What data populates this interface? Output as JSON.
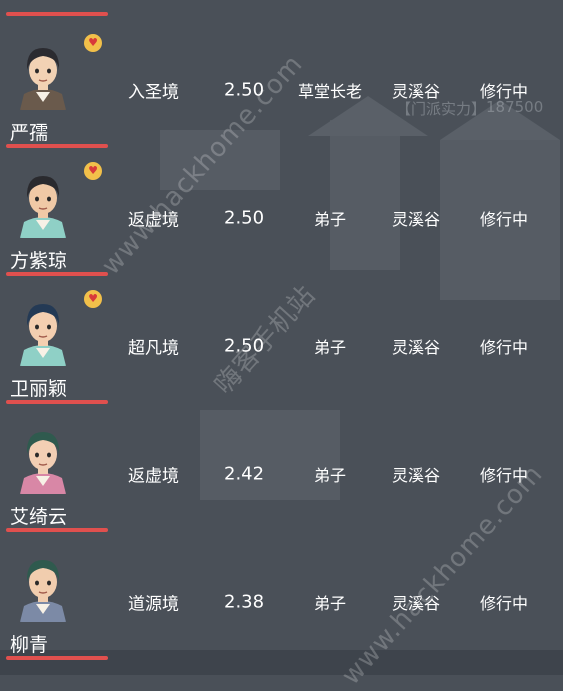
{
  "watermark": {
    "cn": "嗨客手机站",
    "url_top": "www.hackhome.com",
    "url_bottom": "www.hackhome.com"
  },
  "background_text": {
    "power_label": "【门派实力】",
    "power_value": "187500"
  },
  "colors": {
    "accent_bar": "#e0504e",
    "background": "#4a5058",
    "heart": "#f2c04a"
  },
  "disciples": [
    {
      "name": "严孺",
      "realm": "入圣境",
      "value": "2.50",
      "role": "草堂长老",
      "place": "灵溪谷",
      "status": "修行中",
      "icon": "heart-emoji-icon",
      "hair": "#2b2b30",
      "robe": "#6a5a4c",
      "skin": "#f2d2b4"
    },
    {
      "name": "方紫琼",
      "realm": "返虚境",
      "value": "2.50",
      "role": "弟子",
      "place": "灵溪谷",
      "status": "修行中",
      "icon": "heart-emoji-icon",
      "hair": "#2a2a2e",
      "robe": "#8fd0c6",
      "skin": "#f0c9a6"
    },
    {
      "name": "卫丽颖",
      "realm": "超凡境",
      "value": "2.50",
      "role": "弟子",
      "place": "灵溪谷",
      "status": "修行中",
      "icon": "heart-emoji-icon",
      "hair": "#243a55",
      "robe": "#8fd0c6",
      "skin": "#f4cfb0"
    },
    {
      "name": "艾绮云",
      "realm": "返虚境",
      "value": "2.42",
      "role": "弟子",
      "place": "灵溪谷",
      "status": "修行中",
      "icon": "",
      "hair": "#2f5a4e",
      "robe": "#d887a6",
      "skin": "#f3cfb4"
    },
    {
      "name": "柳青",
      "realm": "道源境",
      "value": "2.38",
      "role": "弟子",
      "place": "灵溪谷",
      "status": "修行中",
      "icon": "",
      "hair": "#2f5a4e",
      "robe": "#7c8aa6",
      "skin": "#f1cdae"
    }
  ]
}
